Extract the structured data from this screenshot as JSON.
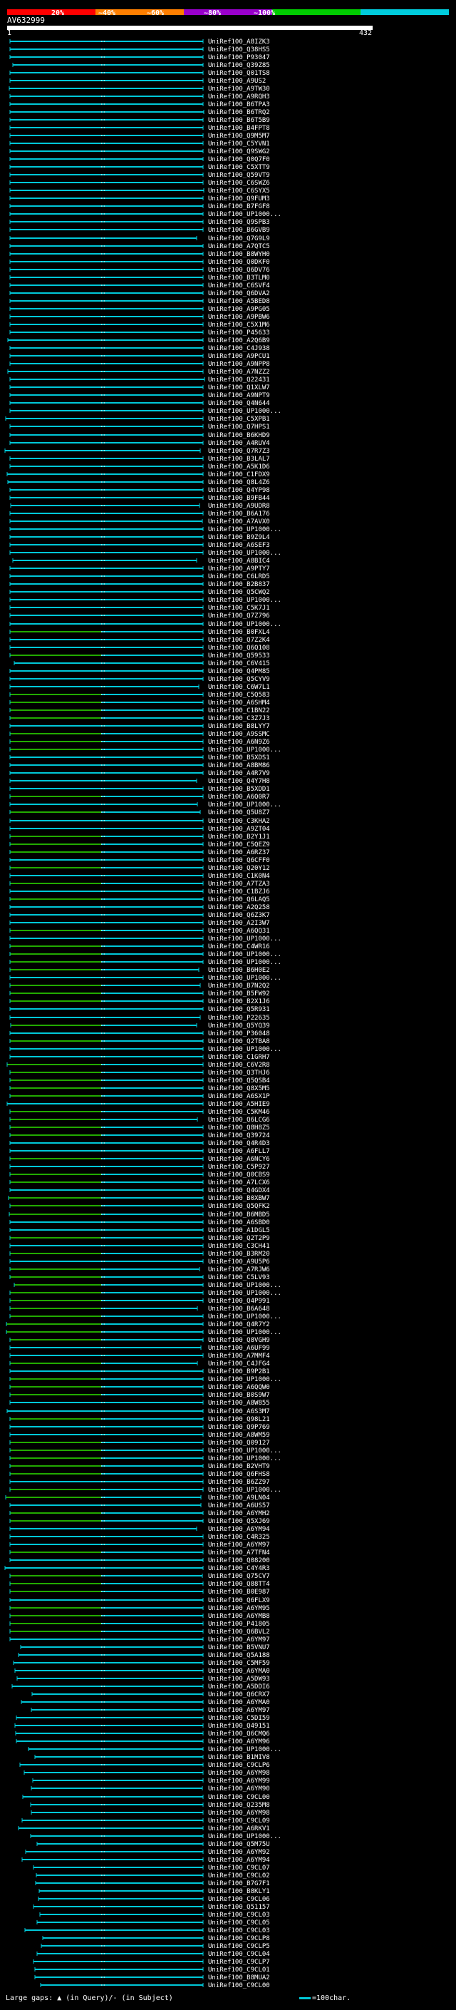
{
  "query": {
    "id": "AV632999",
    "start": "1",
    "end": "432"
  },
  "scale_labels": [
    "20%",
    "~40%",
    "~60%",
    "~80%",
    "~100%"
  ],
  "scale_colors": [
    "#ff0000",
    "#ff7f00",
    "#9900cc",
    "#00cc00",
    "#00ccdd"
  ],
  "legend": {
    "gaps": "Large gaps: ▲ (in Query)/- (in Subject)",
    "unit": "=100char."
  },
  "hits": [
    "UniRef100_A8IZK3",
    "UniRef100_Q38HS5",
    "UniRef100_P93047",
    "UniRef100_Q39Z85",
    "UniRef100_Q01TS8",
    "UniRef100_A9US2",
    "UniRef100_A9TW30",
    "UniRef100_A9RQH3",
    "UniRef100_B6TPA3",
    "UniRef100_B6TRQ2",
    "UniRef100_B6T5B9",
    "UniRef100_B4FPT8",
    "UniRef100_Q9M5M7",
    "UniRef100_C5YVN1",
    "UniRef100_Q9SWG2",
    "UniRef100_Q0Q7F0",
    "UniRef100_C5XTT9",
    "UniRef100_Q59VT9",
    "UniRef100_C6SWZ6",
    "UniRef100_C6SYX5",
    "UniRef100_Q9FUM3",
    "UniRef100_B7FGF8",
    "UniRef100_UP1000...",
    "UniRef100_Q9SPB3",
    "UniRef100_B6GVB9",
    "UniRef100_Q7G9L9",
    "UniRef100_A7QTC5",
    "UniRef100_B8WYH0",
    "UniRef100_Q0DKF0",
    "UniRef100_Q6DV76",
    "UniRef100_B3TLM0",
    "UniRef100_C6SVF4",
    "UniRef100_Q6DVA2",
    "UniRef100_A5BED8",
    "UniRef100_A9PG05",
    "UniRef100_A9PBW6",
    "UniRef100_C5X1M6",
    "UniRef100_P45633",
    "UniRef100_A2Q6B9",
    "UniRef100_C4J938",
    "UniRef100_A9PCU1",
    "UniRef100_A9NPP8",
    "UniRef100_A7NZZ2",
    "UniRef100_Q22431",
    "UniRef100_Q1XLW7",
    "UniRef100_A9NPT9",
    "UniRef100_Q4N644",
    "UniRef100_UP1000...",
    "UniRef100_C5XPB1",
    "UniRef100_Q7HPS1",
    "UniRef100_B6KHD9",
    "UniRef100_A4RUV4",
    "UniRef100_Q7R7Z3",
    "UniRef100_B3LAL7",
    "UniRef100_A5K1D6",
    "UniRef100_C1FDX9",
    "UniRef100_Q8L4Z6",
    "UniRef100_Q4YP98",
    "UniRef100_B9FB44",
    "UniRef100_A9UDR8",
    "UniRef100_B6A176",
    "UniRef100_A7AVX0",
    "UniRef100_UP1000...",
    "UniRef100_B9Z9L4",
    "UniRef100_A6SEF3",
    "UniRef100_UP1000...",
    "UniRef100_A8BIC4",
    "UniRef100_A9PTY7",
    "UniRef100_C6LRD5",
    "UniRef100_B2B837",
    "UniRef100_Q5CWQ2",
    "UniRef100_UP1000...",
    "UniRef100_C5K7J1",
    "UniRef100_Q7Z796",
    "UniRef100_UP1000...",
    "UniRef100_B0FXL4",
    "UniRef100_Q7Z2K4",
    "UniRef100_Q6Q108",
    "UniRef100_Q59533",
    "UniRef100_C6V415",
    "UniRef100_Q4PM85",
    "UniRef100_Q5CYV9",
    "UniRef100_C6W7L1",
    "UniRef100_C5Q583",
    "UniRef100_A6SHM4",
    "UniRef100_C1BN22",
    "UniRef100_C3Z7J3",
    "UniRef100_B8LYY7",
    "UniRef100_A9SSMC",
    "UniRef100_A6N9Z6",
    "UniRef100_UP1000...",
    "UniRef100_B5XDS1",
    "UniRef100_A8BM86",
    "UniRef100_A4R7V9",
    "UniRef100_Q4Y7H8",
    "UniRef100_B5XDD1",
    "UniRef100_A6Q0R7",
    "UniRef100_UP1000...",
    "UniRef100_Q5U8Z7",
    "UniRef100_C3KHA2",
    "UniRef100_A9ZT04",
    "UniRef100_B2Y1J1",
    "UniRef100_C5QEZ9",
    "UniRef100_A6RZ37",
    "UniRef100_Q6CFF0",
    "UniRef100_Q20Y12",
    "UniRef100_C1K0N4",
    "UniRef100_A7TZA3",
    "UniRef100_C1BZJ6",
    "UniRef100_Q6LAQ5",
    "UniRef100_A2Q258",
    "UniRef100_Q6Z3K7",
    "UniRef100_A2I3W7",
    "UniRef100_A6QQ31",
    "UniRef100_UP1000...",
    "UniRef100_C4WR16",
    "UniRef100_UP1000...",
    "UniRef100_UP1000...",
    "UniRef100_B6H0E2",
    "UniRef100_UP1000...",
    "UniRef100_B7N2Q2",
    "UniRef100_B5FW92",
    "UniRef100_B2X1J6",
    "UniRef100_Q5R931",
    "UniRef100_P22635",
    "UniRef100_Q5YQ39",
    "UniRef100_P36048",
    "UniRef100_Q2TBA8",
    "UniRef100_UP1000...",
    "UniRef100_C1GRH7",
    "UniRef100_C6V2R8",
    "UniRef100_Q3THJ6",
    "UniRef100_Q5QSB4",
    "UniRef100_Q8X5M5",
    "UniRef100_A6SX1P",
    "UniRef100_A5HIE9",
    "UniRef100_C5KM46",
    "UniRef100_Q6LCG6",
    "UniRef100_Q8H8Z5",
    "UniRef100_Q39724",
    "UniRef100_Q4R4D3",
    "UniRef100_A6FLL7",
    "UniRef100_A6NCY6",
    "UniRef100_C5P927",
    "UniRef100_Q0CBS9",
    "UniRef100_A7LCX6",
    "UniRef100_Q4GDX4",
    "UniRef100_B0XBW7",
    "UniRef100_Q5QFK2",
    "UniRef100_B6MBD5",
    "UniRef100_A6SBD0",
    "UniRef100_A1DGL5",
    "UniRef100_Q2T2P9",
    "UniRef100_C3CH41",
    "UniRef100_B3RM20",
    "UniRef100_A9U5P6",
    "UniRef100_A7RJW6",
    "UniRef100_C5LV93",
    "UniRef100_UP1000...",
    "UniRef100_UP1000...",
    "UniRef100_Q4P991",
    "UniRef100_B6A648",
    "UniRef100_UP1000...",
    "UniRef100_Q4R7Y2",
    "UniRef100_UP1000...",
    "UniRef100_Q8VGH9",
    "UniRef100_A6UF99",
    "UniRef100_A7MMF4",
    "UniRef100_C4JFG4",
    "UniRef100_B9P2B1",
    "UniRef100_UP1000...",
    "UniRef100_A6QQW0",
    "UniRef100_B0S9W7",
    "UniRef100_A8W855",
    "UniRef100_A6S3M7",
    "UniRef100_Q98L21",
    "UniRef100_Q9P769",
    "UniRef100_A8WM59",
    "UniRef100_Q09127",
    "UniRef100_UP1000...",
    "UniRef100_UP1000...",
    "UniRef100_B2VHT9",
    "UniRef100_Q6FHS8",
    "UniRef100_B6ZZ97",
    "UniRef100_UP1000...",
    "UniRef100_A9LN04",
    "UniRef100_A6US57",
    "UniRef100_A6YMH2",
    "UniRef100_Q5XJ69",
    "UniRef100_A6YM94",
    "UniRef100_C4R325",
    "UniRef100_A6YM97",
    "UniRef100_A7TFN4",
    "UniRef100_Q08200",
    "UniRef100_C4Y4R3",
    "UniRef100_Q75CV7",
    "UniRef100_Q88TT4",
    "UniRef100_B0E987",
    "UniRef100_Q6FLX9",
    "UniRef100_A6YM95",
    "UniRef100_A6YMB8",
    "UniRef100_P41805",
    "UniRef100_Q6BVL2",
    "UniRef100_A6YM97",
    "UniRef100_B5VNU7",
    "UniRef100_Q5A188",
    "UniRef100_C5MF59",
    "UniRef100_A6YMA0",
    "UniRef100_A5DW93",
    "UniRef100_A5DDI6",
    "UniRef100_Q6CRX7",
    "UniRef100_A6YMA0",
    "UniRef100_A6YM97",
    "UniRef100_C5DI59",
    "UniRef100_Q49151",
    "UniRef100_Q6CMQ6",
    "UniRef100_A6YM96",
    "UniRef100_UP1000...",
    "UniRef100_B1MIV8",
    "UniRef100_C9CLP6",
    "UniRef100_A6YM98",
    "UniRef100_A6YM99",
    "UniRef100_A6YM90",
    "UniRef100_C9CL00",
    "UniRef100_Q235M8",
    "UniRef100_A6YM98",
    "UniRef100_C9CL09",
    "UniRef100_A6RKV1",
    "UniRef100_UP1000...",
    "UniRef100_Q5M75U",
    "UniRef100_A6YM92",
    "UniRef100_A6YM94",
    "UniRef100_C9CL07",
    "UniRef100_C9CL02",
    "UniRef100_B7G7F1",
    "UniRef100_B8KLY1",
    "UniRef100_C9CL06",
    "UniRef100_Q51157",
    "UniRef100_C9CL03",
    "UniRef100_C9CL05",
    "UniRef100_C9CL03",
    "UniRef100_C9CLP8",
    "UniRef100_C9CLP5",
    "UniRef100_C9CL04",
    "UniRef100_C9CLP7",
    "UniRef100_C9CL01",
    "UniRef100_B8MUA2",
    "UniRef100_C9CL00"
  ]
}
